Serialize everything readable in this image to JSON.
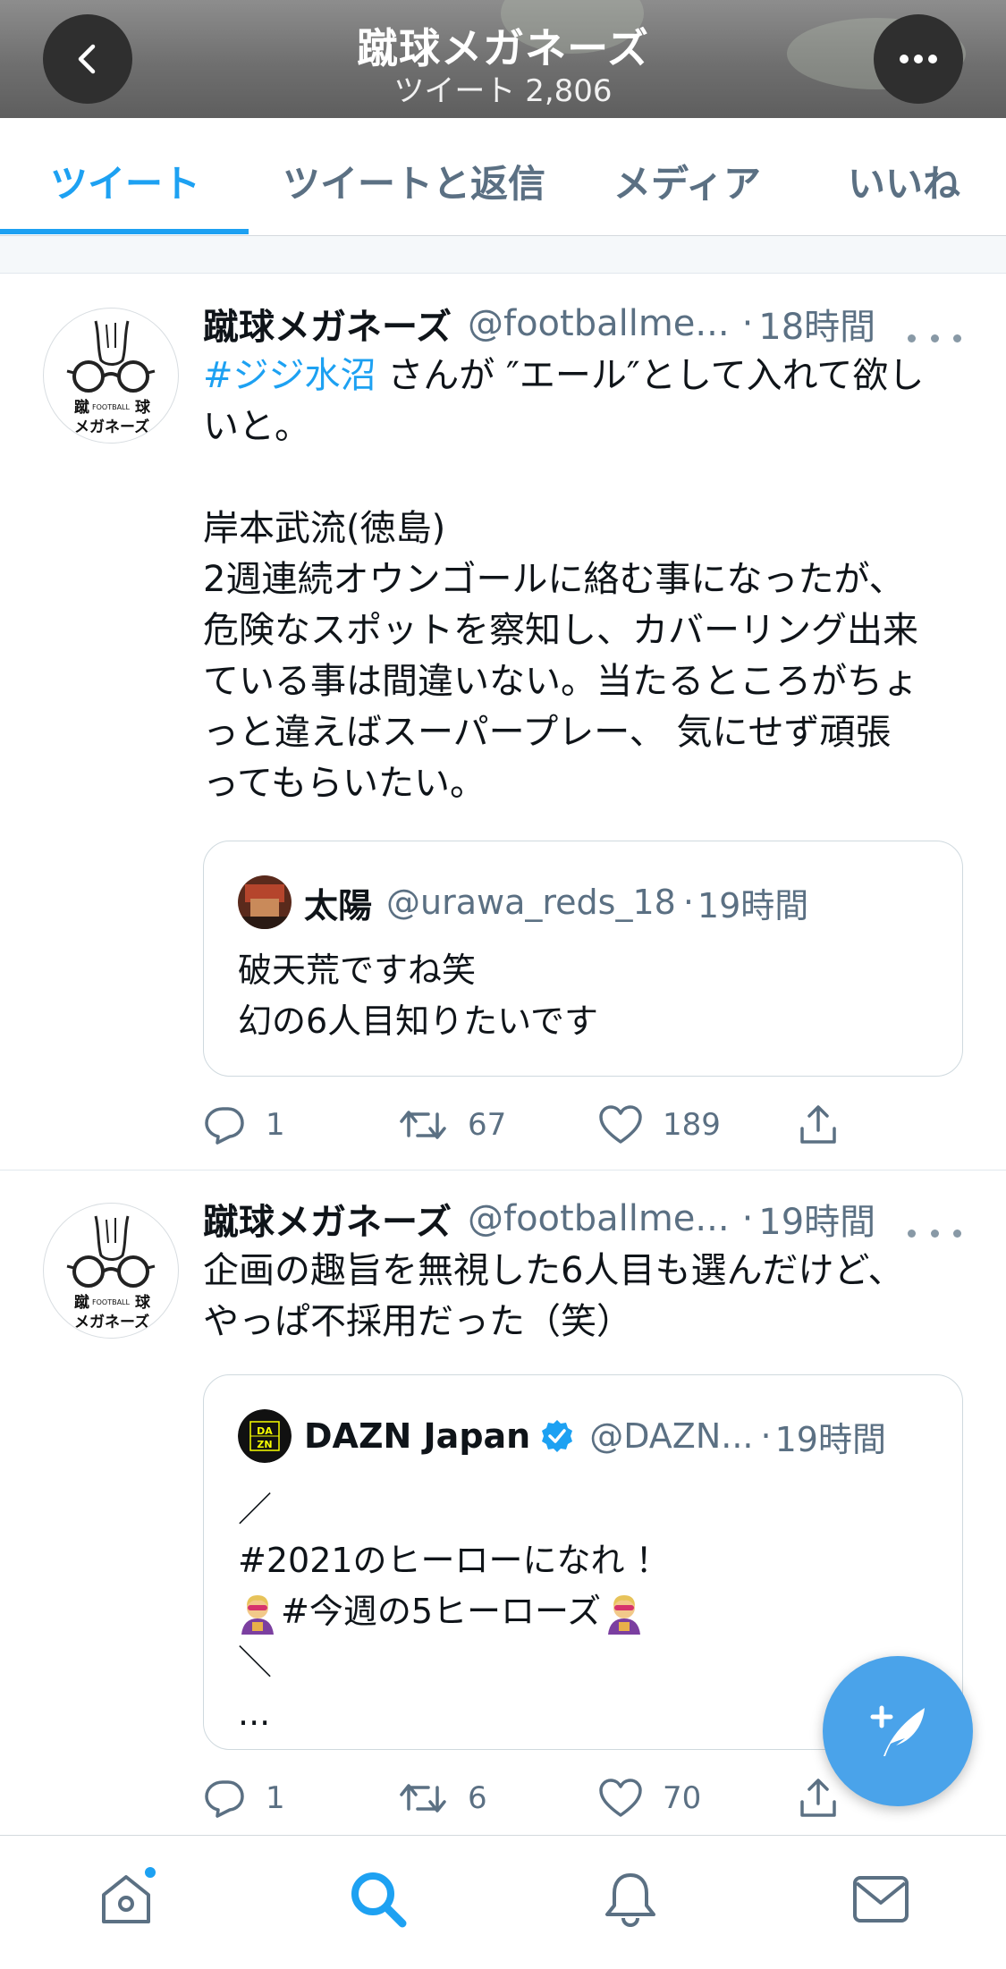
{
  "header": {
    "title": "蹴球メガネーズ",
    "tweet_count": "ツイート 2,806"
  },
  "tabs": [
    {
      "label": "ツイート",
      "active": true
    },
    {
      "label": "ツイートと返信",
      "active": false
    },
    {
      "label": "メディア",
      "active": false
    },
    {
      "label": "いいね",
      "active": false
    }
  ],
  "avatar_logo": {
    "line1_left": "蹴",
    "line1_mid": "FOOTBALL",
    "line1_right": "球",
    "line2": "メガネーズ"
  },
  "tweets": [
    {
      "name": "蹴球メガネーズ",
      "handle": "@footballme...",
      "dot": "·",
      "time": "18時間",
      "hashtag": "#ジジ水沼",
      "line1_rest": " さんが ″エール″として入れて欲し",
      "lines": [
        "いと。",
        "",
        "岸本武流(徳島)",
        "2週連続オウンゴールに絡む事になったが、",
        "危険なスポットを察知し、カバーリング出来",
        "ている事は間違いない。当たるところがちょ",
        "っと違えばスーパープレー、 気にせず頑張",
        "ってもらいたい。"
      ],
      "quote": {
        "name": "太陽",
        "handle": "@urawa_reds_18",
        "dot": "·",
        "time": "19時間",
        "lines": [
          "破天荒ですね笑",
          "幻の6人目知りたいです"
        ]
      },
      "actions": {
        "replies": "1",
        "retweets": "67",
        "likes": "189"
      }
    },
    {
      "name": "蹴球メガネーズ",
      "handle": "@footballme...",
      "dot": "·",
      "time": "19時間",
      "lines": [
        "企画の趣旨を無視した6人目も選んだけど、",
        "やっぱ不採用だった（笑）"
      ],
      "quote": {
        "name": "DAZN Japan",
        "avatar_text": "DAZN",
        "handle": "@DAZN...",
        "dot": "·",
        "time": "19時間",
        "lines": [
          "／",
          "#2021のヒーローになれ ！",
          "#今週の5ヒーローズ",
          "＼",
          "..."
        ]
      },
      "actions": {
        "replies": "1",
        "retweets": "6",
        "likes": "70"
      }
    }
  ],
  "colors": {
    "accent": "#1da1f2",
    "muted": "#5b7083",
    "fab": "#4aa3ea"
  },
  "icons": [
    "back-arrow-icon",
    "more-icon",
    "reply-icon",
    "retweet-icon",
    "like-icon",
    "share-icon",
    "compose-icon",
    "home-icon",
    "search-icon",
    "notifications-icon",
    "messages-icon",
    "verified-badge-icon",
    "superhero-emoji-icon"
  ]
}
